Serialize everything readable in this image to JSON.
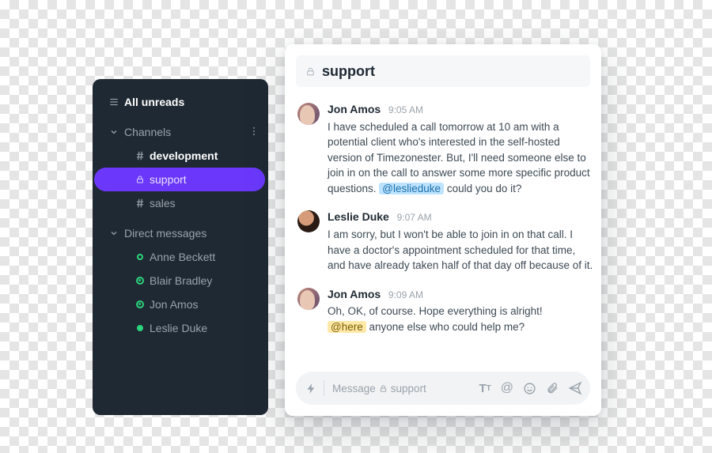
{
  "sidebar": {
    "title": "All unreads",
    "sections": {
      "channels": {
        "label": "Channels",
        "items": [
          {
            "icon": "hash",
            "label": "development",
            "bold": true
          },
          {
            "icon": "lock",
            "label": "support",
            "active": true
          },
          {
            "icon": "hash",
            "label": "sales"
          }
        ]
      },
      "dms": {
        "label": "Direct messages",
        "items": [
          {
            "presence": "outline",
            "label": "Anne Beckett"
          },
          {
            "presence": "away",
            "label": "Blair Bradley"
          },
          {
            "presence": "away",
            "label": "Jon Amos"
          },
          {
            "presence": "online",
            "label": "Leslie Duke"
          }
        ]
      }
    }
  },
  "channel": {
    "name": "support"
  },
  "messages": [
    {
      "author": "Jon Amos",
      "time": "9:05 AM",
      "avatar": "jon",
      "body_pre": "I have scheduled a call tomorrow at 10 am with a potential client who's interested in the self-hosted version of Timezonester. But, I'll need someone else to join in on the call to answer some more specific product questions. ",
      "mention": "@leslieduke",
      "mention_kind": "user",
      "body_post": " could you do it?"
    },
    {
      "author": "Leslie Duke",
      "time": "9:07 AM",
      "avatar": "leslie",
      "body_pre": "I am sorry, but I won't be able to join in on that call. I have a doctor's appointment scheduled for that time, and have already taken half of that day off because of it.",
      "mention": "",
      "mention_kind": "",
      "body_post": ""
    },
    {
      "author": "Jon Amos",
      "time": "9:09 AM",
      "avatar": "jon",
      "body_pre": "Oh, OK, of course. Hope everything is alright!\n",
      "mention": "@here",
      "mention_kind": "here",
      "body_post": " anyone else who could help me?"
    }
  ],
  "composer": {
    "placeholder_prefix": "Message",
    "placeholder_channel": "support"
  }
}
